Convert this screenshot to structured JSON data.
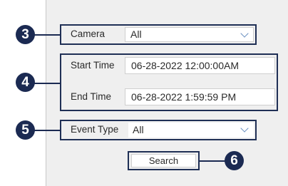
{
  "callouts": [
    "3",
    "4",
    "5",
    "6"
  ],
  "camera": {
    "label": "Camera",
    "value": "All"
  },
  "start_time": {
    "label": "Start Time",
    "value": "06-28-2022 12:00:00AM"
  },
  "end_time": {
    "label": "End Time",
    "value": "06-28-2022 1:59:59 PM"
  },
  "event_type": {
    "label": "Event Type",
    "value": "All"
  },
  "search_label": "Search",
  "colors": {
    "callout": "#1b2a52",
    "panel": "#efefef",
    "chevron": "#6a8fc0"
  }
}
